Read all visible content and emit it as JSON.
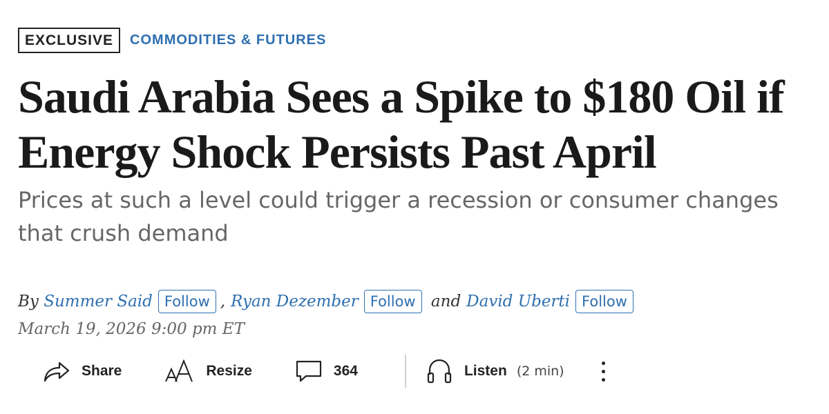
{
  "article": {
    "badge": "EXCLUSIVE",
    "category": "COMMODITIES & FUTURES",
    "headline": "Saudi Arabia Sees a Spike to $180 Oil if Energy Shock Persists Past April",
    "dek": "Prices at such a level could trigger a recession or consumer changes that crush demand",
    "byline": {
      "by": "By",
      "authors": [
        "Summer Said",
        "Ryan Dezember",
        "David Uberti"
      ],
      "follow_label": "Follow",
      "comma": ",",
      "and": "and"
    },
    "date": "March 19, 2026 9:00 pm ET"
  },
  "toolbar": {
    "share_label": "Share",
    "resize_label": "Resize",
    "comment_count": "364",
    "listen_label": "Listen",
    "listen_duration": "(2 min)",
    "icons": [
      "share-icon",
      "resize-icon",
      "comment-icon",
      "headphones-icon",
      "more-vertical-icon"
    ]
  },
  "colors": {
    "link": "#2e6fb0",
    "dek_text": "#666666",
    "headline_text": "#1a1a1a"
  }
}
